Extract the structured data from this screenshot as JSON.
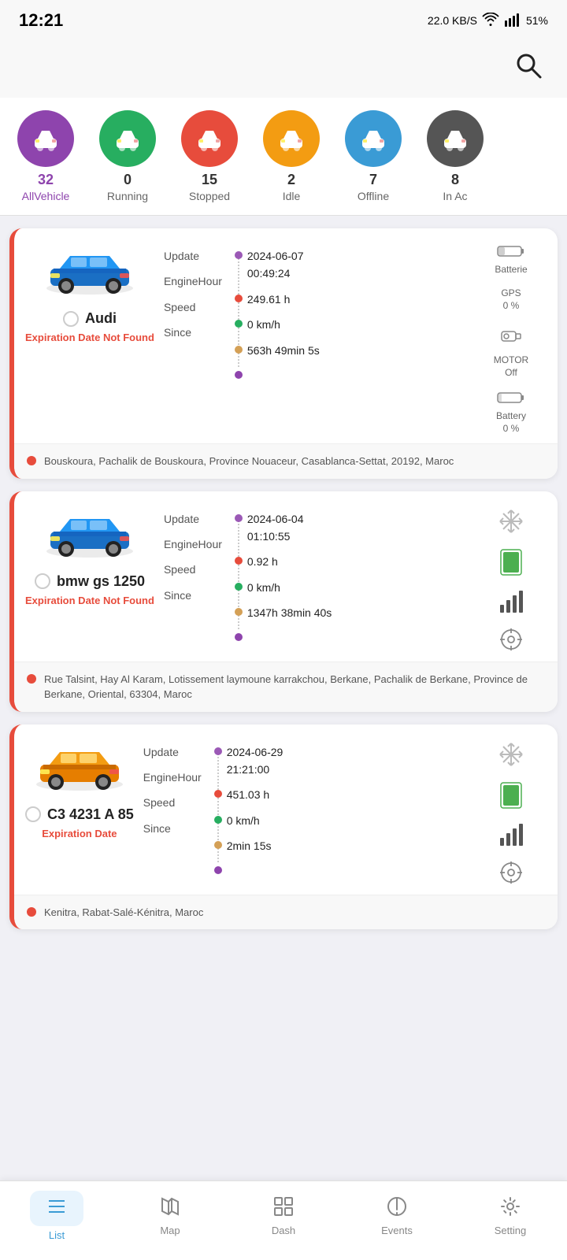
{
  "statusBar": {
    "time": "12:21",
    "network": "22.0 KB/S",
    "battery": "51%"
  },
  "search": {
    "label": "Search"
  },
  "categories": [
    {
      "id": "all",
      "count": "32",
      "label": "AllVehicle",
      "color": "#8e44ad",
      "active": true
    },
    {
      "id": "running",
      "count": "0",
      "label": "Running",
      "color": "#27ae60",
      "active": false
    },
    {
      "id": "stopped",
      "count": "15",
      "label": "Stopped",
      "color": "#e74c3c",
      "active": false
    },
    {
      "id": "idle",
      "count": "2",
      "label": "Idle",
      "color": "#f39c12",
      "active": false
    },
    {
      "id": "offline",
      "count": "7",
      "label": "Offline",
      "color": "#3a9bd5",
      "active": false
    },
    {
      "id": "inac",
      "count": "8",
      "label": "In Ac",
      "color": "#555",
      "active": false
    }
  ],
  "vehicles": [
    {
      "name": "Audi",
      "color": "blue",
      "update": "2024-06-07",
      "updateTime": "00:49:24",
      "engineHour": "249.61 h",
      "speed": "0 km/h",
      "since": "563h 49min 5s",
      "expiry": "Expiration Date Not Found",
      "address": "Bouskoura, Pachalik de Bouskoura, Province Nouaceur, Casablanca-Settat, 20192, Maroc",
      "batterie": "Batterie",
      "batterieVal": "0 %",
      "gps": "GPS",
      "gpsVal": "0 %",
      "motor": "MOTOR",
      "motorVal": "Off",
      "battery": "Battery",
      "batteryVal": "0 %",
      "dotColors": [
        "#9b59b6",
        "#e74c3c",
        "#27ae60",
        "#d4a056",
        "#8e44ad"
      ]
    },
    {
      "name": "bmw gs 1250",
      "color": "blue",
      "update": "2024-06-04",
      "updateTime": "01:10:55",
      "engineHour": "0.92 h",
      "speed": "0 km/h",
      "since": "1347h 38min 40s",
      "expiry": "Expiration Date Not Found",
      "address": "Rue Talsint, Hay Al Karam, Lotissement laymoune karrakchou, Berkane, Pachalik de Berkane, Province de Berkane, Oriental, 63304, Maroc",
      "dotColors": [
        "#9b59b6",
        "#e74c3c",
        "#27ae60",
        "#d4a056",
        "#8e44ad"
      ]
    },
    {
      "name": "C3 4231 A 85",
      "color": "orange",
      "update": "2024-06-29",
      "updateTime": "21:21:00",
      "engineHour": "451.03 h",
      "speed": "0 km/h",
      "since": "2min 15s",
      "expiry": "Expiration Date",
      "address": "Kenitra, Rabat-Salé-Kénitra, Maroc",
      "dotColors": [
        "#9b59b6",
        "#e74c3c",
        "#27ae60",
        "#d4a056",
        "#8e44ad"
      ]
    }
  ],
  "nav": {
    "items": [
      {
        "id": "list",
        "label": "List",
        "active": true
      },
      {
        "id": "map",
        "label": "Map",
        "active": false
      },
      {
        "id": "dash",
        "label": "Dash",
        "active": false
      },
      {
        "id": "events",
        "label": "Events",
        "active": false
      },
      {
        "id": "setting",
        "label": "Setting",
        "active": false
      }
    ]
  }
}
